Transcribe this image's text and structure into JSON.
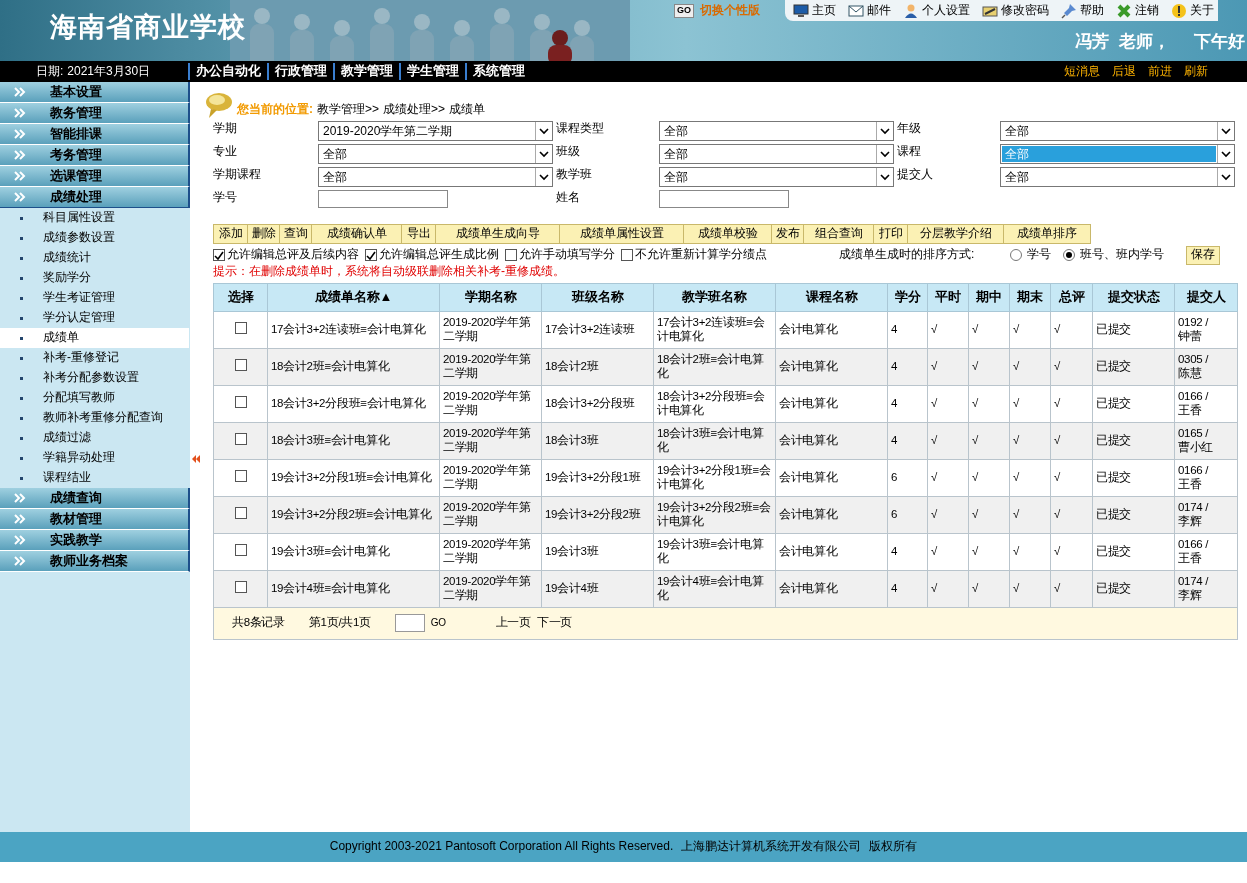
{
  "header": {
    "school": "海南省商业学校",
    "skin_button": "GO",
    "skin_link": "切换个性版",
    "greeting_name": "冯芳",
    "greeting_title": "老师，",
    "greeting_time": "下午好",
    "top_links": [
      "主页",
      "邮件",
      "个人设置",
      "修改密码",
      "帮助",
      "注销",
      "关于"
    ]
  },
  "nav": {
    "date_label": "日期:",
    "date": "2021年3月30日",
    "menus": [
      "办公自动化",
      "行政管理",
      "教学管理",
      "学生管理",
      "系统管理"
    ],
    "actions": [
      "短消息",
      "后退",
      "前进",
      "刷新"
    ]
  },
  "sidebar": {
    "sections": [
      {
        "label": "基本设置",
        "expanded": false
      },
      {
        "label": "教务管理",
        "expanded": false
      },
      {
        "label": "智能排课",
        "expanded": false
      },
      {
        "label": "考务管理",
        "expanded": false
      },
      {
        "label": "选课管理",
        "expanded": false
      },
      {
        "label": "成绩处理",
        "expanded": true,
        "items": [
          {
            "label": "科目属性设置",
            "selected": false
          },
          {
            "label": "成绩参数设置",
            "selected": false
          },
          {
            "label": "成绩统计",
            "selected": false
          },
          {
            "label": "奖励学分",
            "selected": false
          },
          {
            "label": "学生考证管理",
            "selected": false
          },
          {
            "label": "学分认定管理",
            "selected": false
          },
          {
            "label": "成绩单",
            "selected": true
          },
          {
            "label": "补考-重修登记",
            "selected": false
          },
          {
            "label": "补考分配参数设置",
            "selected": false
          },
          {
            "label": "分配填写教师",
            "selected": false
          },
          {
            "label": "教师补考重修分配查询",
            "selected": false
          },
          {
            "label": "成绩过滤",
            "selected": false
          },
          {
            "label": "学籍异动处理",
            "selected": false
          },
          {
            "label": "课程结业",
            "selected": false
          }
        ]
      },
      {
        "label": "成绩查询",
        "expanded": false
      },
      {
        "label": "教材管理",
        "expanded": false
      },
      {
        "label": "实践教学",
        "expanded": false
      },
      {
        "label": "教师业务档案",
        "expanded": false
      }
    ]
  },
  "breadcrumb": {
    "label": "您当前的位置:",
    "path": [
      "教学管理>>",
      "成绩处理>>",
      "成绩单"
    ]
  },
  "filters": [
    {
      "label": "学期",
      "kind": "select",
      "value": "2019-2020学年第二学期",
      "highlighted": false
    },
    {
      "label": "课程类型",
      "kind": "select",
      "value": "全部",
      "highlighted": false
    },
    {
      "label": "年级",
      "kind": "select",
      "value": "全部",
      "highlighted": false
    },
    {
      "label": "专业",
      "kind": "select",
      "value": "全部",
      "highlighted": false
    },
    {
      "label": "班级",
      "kind": "select",
      "value": "全部",
      "highlighted": false
    },
    {
      "label": "课程",
      "kind": "select",
      "value": "全部",
      "highlighted": true
    },
    {
      "label": "学期课程",
      "kind": "select",
      "value": "全部",
      "highlighted": false
    },
    {
      "label": "教学班",
      "kind": "select",
      "value": "全部",
      "highlighted": false
    },
    {
      "label": "提交人",
      "kind": "select",
      "value": "全部",
      "highlighted": false
    },
    {
      "label": "学号",
      "kind": "input",
      "highlighted": false
    },
    {
      "label": "姓名",
      "kind": "input",
      "highlighted": false
    }
  ],
  "toolbar": [
    "添加",
    "删除",
    "查询",
    "成绩确认单",
    "导出",
    "成绩单生成向导",
    "成绩单属性设置",
    "成绩单校验",
    "发布",
    "组合查询",
    "打印",
    "分层教学介绍",
    "成绩单排序"
  ],
  "options": [
    {
      "label": "允许编辑总评及后续内容",
      "checked": true
    },
    {
      "label": "允许编辑总评生成比例",
      "checked": true
    },
    {
      "label": "允许手动填写学分",
      "checked": false
    },
    {
      "label": "不允许重新计算学分绩点",
      "checked": false
    }
  ],
  "sort_label": "成绩单生成时的排序方式:",
  "sort_options": [
    {
      "label": "学号",
      "selected": false
    },
    {
      "label": "班号、班内学号",
      "selected": true
    }
  ],
  "save": "保存",
  "warning": "提示：在删除成绩单时，系统将自动级联删除相关补考-重修成绩。",
  "table": {
    "columns": [
      "选择",
      "成绩单名称▲",
      "学期名称",
      "班级名称",
      "教学班名称",
      "课程名称",
      "学分",
      "平时",
      "期中",
      "期末",
      "总评",
      "提交状态",
      "提交人"
    ],
    "rows": [
      {
        "cells": [
          {
            "checked": false
          },
          "17会计3+2连读班≡会计电算化",
          "2019-2020学年第二学期",
          "17会计3+2连读班",
          "17会计3+2连读班≡会计电算化",
          "会计电算化",
          "4",
          "√",
          "√",
          "√",
          "√",
          "已提交",
          "0192 /\n钟蕾"
        ]
      },
      {
        "cells": [
          {
            "checked": false
          },
          "18会计2班≡会计电算化",
          "2019-2020学年第二学期",
          "18会计2班",
          "18会计2班≡会计电算化",
          "会计电算化",
          "4",
          "√",
          "√",
          "√",
          "√",
          "已提交",
          "0305 /\n陈慧"
        ]
      },
      {
        "cells": [
          {
            "checked": false
          },
          "18会计3+2分段班≡会计电算化",
          "2019-2020学年第二学期",
          "18会计3+2分段班",
          "18会计3+2分段班≡会计电算化",
          "会计电算化",
          "4",
          "√",
          "√",
          "√",
          "√",
          "已提交",
          "0166 /\n王香"
        ]
      },
      {
        "cells": [
          {
            "checked": false
          },
          "18会计3班≡会计电算化",
          "2019-2020学年第二学期",
          "18会计3班",
          "18会计3班≡会计电算化",
          "会计电算化",
          "4",
          "√",
          "√",
          "√",
          "√",
          "已提交",
          "0165 /\n曹小红"
        ]
      },
      {
        "cells": [
          {
            "checked": false
          },
          "19会计3+2分段1班≡会计电算化",
          "2019-2020学年第二学期",
          "19会计3+2分段1班",
          "19会计3+2分段1班≡会计电算化",
          "会计电算化",
          "6",
          "√",
          "√",
          "√",
          "√",
          "已提交",
          "0166 /\n王香"
        ]
      },
      {
        "cells": [
          {
            "checked": false
          },
          "19会计3+2分段2班≡会计电算化",
          "2019-2020学年第二学期",
          "19会计3+2分段2班",
          "19会计3+2分段2班≡会计电算化",
          "会计电算化",
          "6",
          "√",
          "√",
          "√",
          "√",
          "已提交",
          "0174 /\n李辉"
        ]
      },
      {
        "cells": [
          {
            "checked": false
          },
          "19会计3班≡会计电算化",
          "2019-2020学年第二学期",
          "19会计3班",
          "19会计3班≡会计电算化",
          "会计电算化",
          "4",
          "√",
          "√",
          "√",
          "√",
          "已提交",
          "0166 /\n王香"
        ]
      },
      {
        "cells": [
          {
            "checked": false
          },
          "19会计4班≡会计电算化",
          "2019-2020学年第二学期",
          "19会计4班",
          "19会计4班≡会计电算化",
          "会计电算化",
          "4",
          "√",
          "√",
          "√",
          "√",
          "已提交",
          "0174 /\n李辉"
        ]
      }
    ]
  },
  "pager": {
    "total": "共8条记录",
    "page": "第1页/共1页",
    "go": "GO",
    "prev": "上一页",
    "next": "下一页"
  },
  "footer": {
    "copyright": "Copyright 2003-2021 Pantosoft Corporation All Rights Reserved.",
    "company": "上海鹏达计算机系统开发有限公司",
    "rights": "版权所有"
  }
}
